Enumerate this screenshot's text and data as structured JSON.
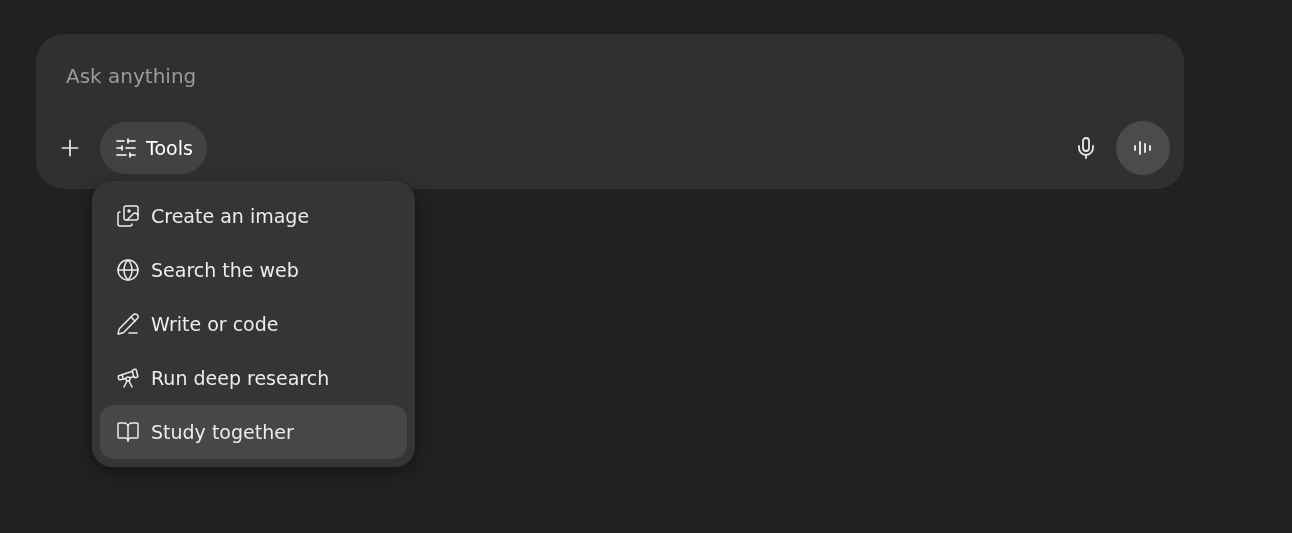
{
  "composer": {
    "placeholder": "Ask anything",
    "tools_button": {
      "label": "Tools",
      "expanded": true
    }
  },
  "tools_menu": [
    {
      "kind": "image",
      "label": "Create an image",
      "selected": false
    },
    {
      "kind": "web",
      "label": "Search the web",
      "selected": false
    },
    {
      "kind": "write",
      "label": "Write or code",
      "selected": false
    },
    {
      "kind": "research",
      "label": "Run deep research",
      "selected": false
    },
    {
      "kind": "study",
      "label": "Study together",
      "selected": true
    }
  ]
}
